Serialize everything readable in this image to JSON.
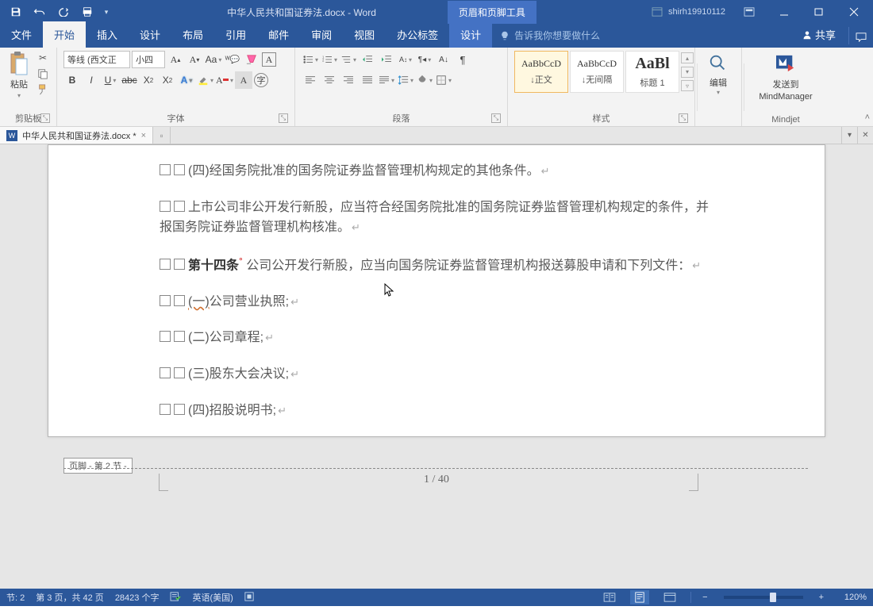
{
  "titlebar": {
    "doc_title": "中华人民共和国证券法.docx - Word",
    "tool_tab": "页眉和页脚工具",
    "username": "shirh19910112"
  },
  "menu": {
    "file": "文件",
    "home": "开始",
    "insert": "插入",
    "design": "设计",
    "layout": "布局",
    "references": "引用",
    "mail": "邮件",
    "review": "审阅",
    "view": "视图",
    "office_tab": "办公标签",
    "hf_design": "设计",
    "tell_me": "告诉我你想要做什么",
    "share": "共享"
  },
  "ribbon": {
    "clipboard": {
      "label": "剪贴板",
      "paste": "粘贴"
    },
    "font": {
      "label": "字体",
      "name": "等线 (西文正",
      "size": "小四"
    },
    "paragraph": {
      "label": "段落"
    },
    "styles": {
      "label": "样式",
      "s1_prev": "AaBbCcD",
      "s1_name": "↓正文",
      "s2_prev": "AaBbCcD",
      "s2_name": "↓无间隔",
      "s3_prev": "AaBl",
      "s3_name": "标题 1"
    },
    "editing": {
      "label": "编辑"
    },
    "mindjet": {
      "label": "Mindjet",
      "send": "发送到",
      "mm": "MindManager"
    }
  },
  "doctab": {
    "name": "中华人民共和国证券法.docx *"
  },
  "document": {
    "p1": "(四)经国务院批准的国务院证券监督管理机构规定的其他条件。",
    "p2": "上市公司非公开发行新股，应当符合经国务院批准的国务院证券监督管理机构规定的条件，并报国务院证券监督管理机构核准。",
    "p3a": "第十四条",
    "p3b": " 公司公开发行新股，应当向国务院证券监督管理机构报送募股申请和下列文件：",
    "p4a": "(一)",
    "p4b": "公司营业执照;",
    "p5": "(二)公司章程;",
    "p6": "(三)股东大会决议;",
    "p7": "(四)招股说明书;",
    "footer_label": "页脚 - 第 2 节 -",
    "page_num": "1 / 40"
  },
  "status": {
    "section": "节: 2",
    "pages": "第 3 页，共 42 页",
    "words": "28423 个字",
    "lang": "英语(美国)",
    "zoom": "120%"
  }
}
